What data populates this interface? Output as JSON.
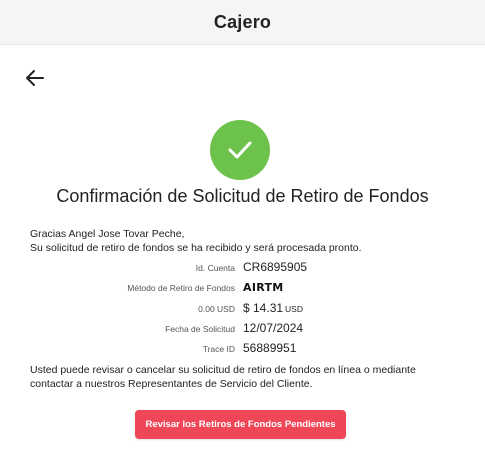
{
  "header": {
    "title": "Cajero"
  },
  "confirmation": {
    "title": "Confirmación de Solicitud de Retiro de Fondos",
    "greeting": "Gracias Angel Jose Tovar Peche,",
    "message": "Su solicitud de retiro de fondos se ha recibido y será procesada pronto."
  },
  "details": {
    "account_label": "Id. Cuenta",
    "account_value": "CR6895905",
    "method_label": "Método de Retiro de Fondos",
    "method_value": "AIRTM",
    "amount_label": "0.00 USD",
    "amount_value": "$ 14.31",
    "amount_unit": "USD",
    "date_label": "Fecha de Solicitud",
    "date_value": "12/07/2024",
    "trace_label": "Trace ID",
    "trace_value": "56889951"
  },
  "notice": "Usted puede revisar o cancelar su solicitud de retiro de fondos en línea o mediante contactar a nuestros Representantes de Servicio del Cliente.",
  "actions": {
    "review_label": "Revisar los Retiros de Fondos Pendientes"
  },
  "icons": {
    "back": "arrow-left-icon",
    "success": "checkmark-icon"
  },
  "colors": {
    "success": "#6cc24a",
    "button": "#ef4757",
    "header_bg": "#f5f5f5"
  }
}
